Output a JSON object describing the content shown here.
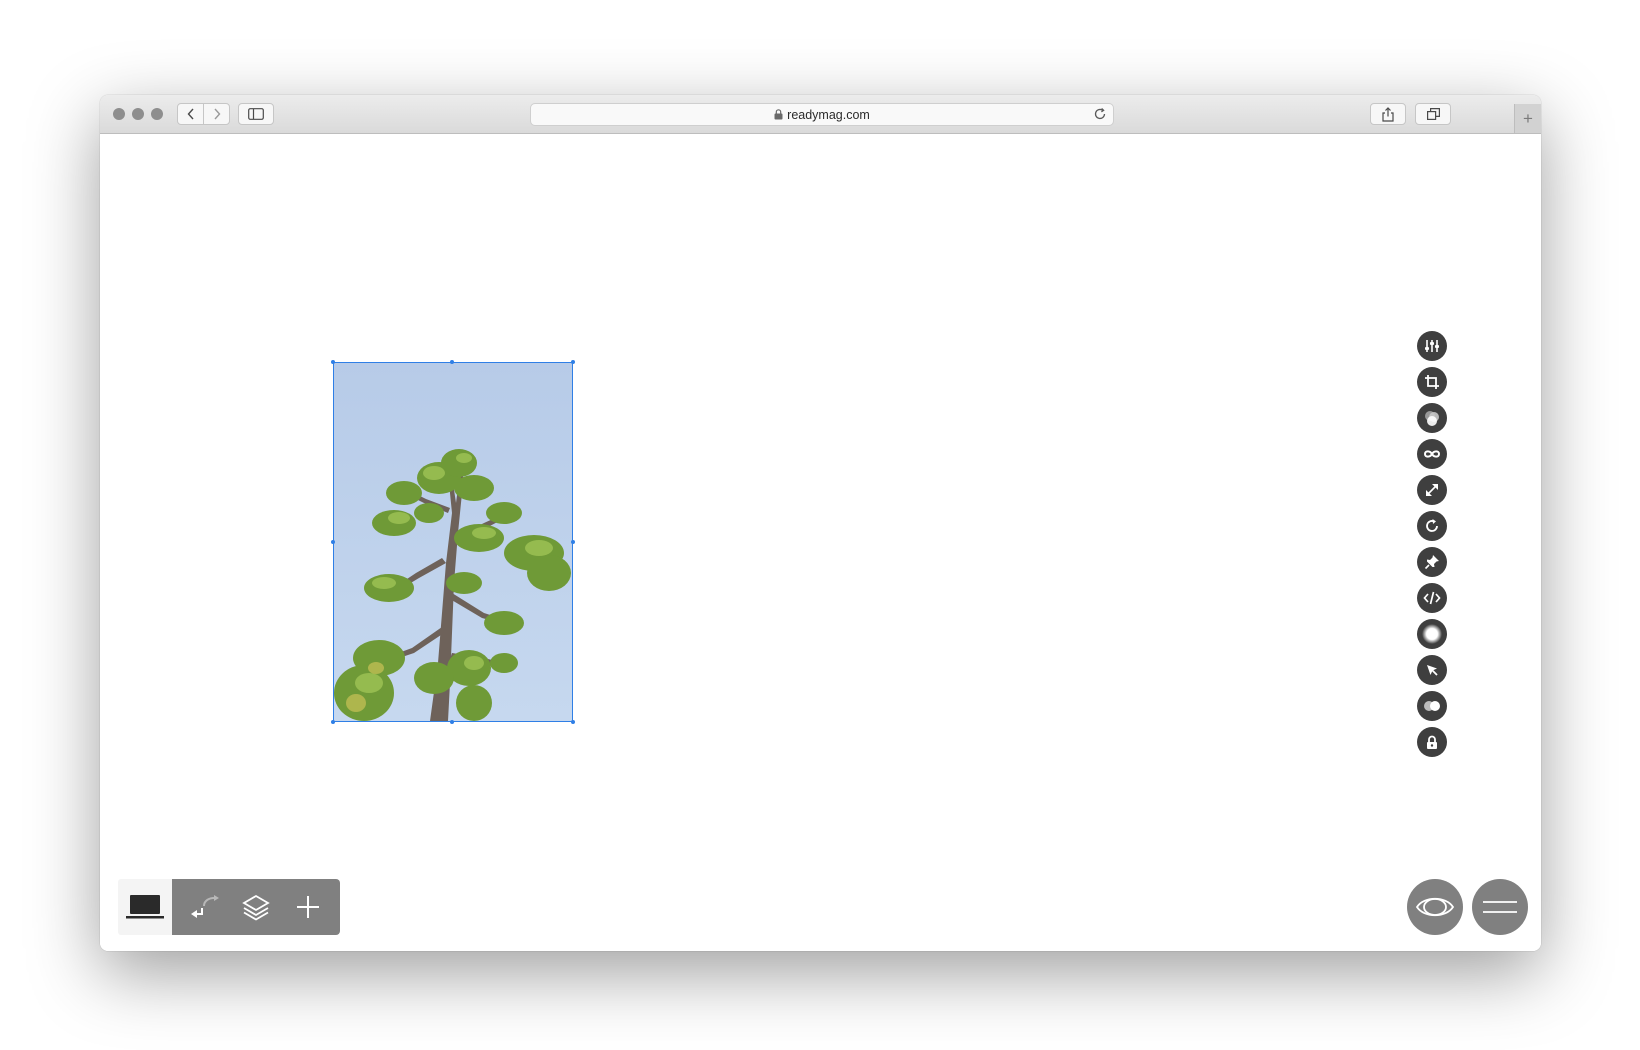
{
  "browser": {
    "url": "readymag.com",
    "new_tab_symbol": "+"
  },
  "canvas": {
    "image_block": {
      "description_icon": "tree-photo",
      "selected": true
    }
  },
  "widget_toolbar": {
    "items": [
      {
        "name": "settings-sliders-icon"
      },
      {
        "name": "crop-icon"
      },
      {
        "name": "color-blend-icon"
      },
      {
        "name": "link-infinity-icon"
      },
      {
        "name": "resize-arrows-icon"
      },
      {
        "name": "rotate-icon"
      },
      {
        "name": "pin-icon"
      },
      {
        "name": "code-embed-icon"
      },
      {
        "name": "shadow-gradient-icon"
      },
      {
        "name": "cursor-animation-icon"
      },
      {
        "name": "opacity-toggle-icon"
      },
      {
        "name": "lock-icon"
      }
    ]
  },
  "bottom_bar": {
    "device": "desktop-laptop-icon",
    "tools": [
      "link-arrow-icon",
      "layers-icon",
      "add-plus-icon"
    ]
  },
  "colors": {
    "selection": "#2f7fe6",
    "panel_gray": "#808080",
    "widget_dark": "#3f3f3f"
  }
}
